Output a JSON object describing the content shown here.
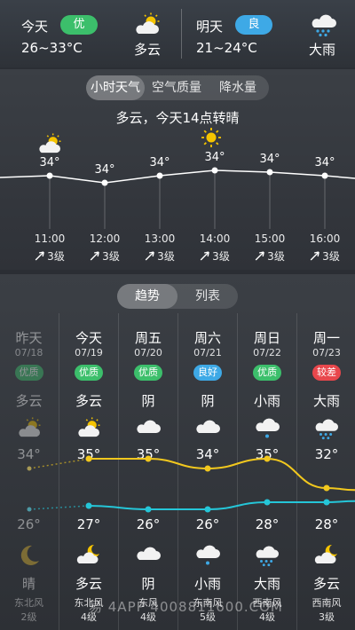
{
  "today": {
    "label": "今天",
    "aqi": "优",
    "aqi_color": "#3cbf6b",
    "temp": "26~33°C",
    "condition": "多云",
    "icon": "partly-cloudy-icon"
  },
  "tomorrow": {
    "label": "明天",
    "aqi": "良",
    "aqi_color": "#3ea9e6",
    "temp": "21~24°C",
    "condition": "大雨",
    "icon": "heavy-rain-icon"
  },
  "hourly": {
    "tabs": [
      "小时天气",
      "空气质量",
      "降水量"
    ],
    "active_tab": 0,
    "summary": "多云，今天14点转晴",
    "times": [
      "11:00",
      "12:00",
      "13:00",
      "14:00",
      "15:00",
      "16:00"
    ],
    "temps": [
      "34°",
      "34°",
      "34°",
      "34°",
      "34°",
      "34°"
    ],
    "temp_values": [
      34,
      33.6,
      34,
      34.3,
      34.2,
      34
    ],
    "icons": [
      "partly-cloudy-icon",
      "",
      "",
      "sun-icon",
      "",
      ""
    ],
    "winds": [
      "3级",
      "3级",
      "3级",
      "3级",
      "3级",
      "3级"
    ]
  },
  "daily": {
    "tabs": [
      "趋势",
      "列表"
    ],
    "active_tab": 0,
    "days": [
      {
        "name": "昨天",
        "date": "07/18",
        "aqi": "优质",
        "aqi_color": "#3cbf6b",
        "day_cond": "多云",
        "day_icon": "partly-cloudy-icon",
        "high": "34°",
        "high_v": 34,
        "low": "26°",
        "low_v": 26,
        "night_icon": "moon-icon",
        "night_cond": "晴",
        "wind": "东北风",
        "level": "2级",
        "past": true
      },
      {
        "name": "今天",
        "date": "07/19",
        "aqi": "优质",
        "aqi_color": "#3cbf6b",
        "day_cond": "多云",
        "day_icon": "partly-cloudy-icon",
        "high": "35°",
        "high_v": 35,
        "low": "27°",
        "low_v": 27,
        "night_icon": "cloud-moon-icon",
        "night_cond": "多云",
        "wind": "东北风",
        "level": "4级",
        "past": false
      },
      {
        "name": "周五",
        "date": "07/20",
        "aqi": "优质",
        "aqi_color": "#3cbf6b",
        "day_cond": "阴",
        "day_icon": "cloud-icon",
        "high": "35°",
        "high_v": 35,
        "low": "26°",
        "low_v": 26,
        "night_icon": "cloud-icon",
        "night_cond": "阴",
        "wind": "东风",
        "level": "4级",
        "past": false
      },
      {
        "name": "周六",
        "date": "07/21",
        "aqi": "良好",
        "aqi_color": "#3ea9e6",
        "day_cond": "阴",
        "day_icon": "cloud-icon",
        "high": "34°",
        "high_v": 34,
        "low": "26°",
        "low_v": 26,
        "night_icon": "light-rain-icon",
        "night_cond": "小雨",
        "wind": "东南风",
        "level": "5级",
        "past": false
      },
      {
        "name": "周日",
        "date": "07/22",
        "aqi": "优质",
        "aqi_color": "#3cbf6b",
        "day_cond": "小雨",
        "day_icon": "light-rain-icon",
        "high": "35°",
        "high_v": 35,
        "low": "28°",
        "low_v": 28,
        "night_icon": "heavy-rain-icon",
        "night_cond": "大雨",
        "wind": "西南风",
        "level": "4级",
        "past": false
      },
      {
        "name": "周一",
        "date": "07/23",
        "aqi": "较差",
        "aqi_color": "#e8474c",
        "day_cond": "大雨",
        "day_icon": "heavy-rain-icon",
        "high": "32°",
        "high_v": 32,
        "low": "28°",
        "low_v": 28,
        "night_icon": "cloud-moon-icon",
        "night_cond": "多云",
        "wind": "西南风",
        "level": "3级",
        "past": false
      }
    ]
  },
  "colors": {
    "high_line": "#f2c81e",
    "low_line": "#25c6d8"
  },
  "watermark": "易 4APP 4008811600.COM"
}
